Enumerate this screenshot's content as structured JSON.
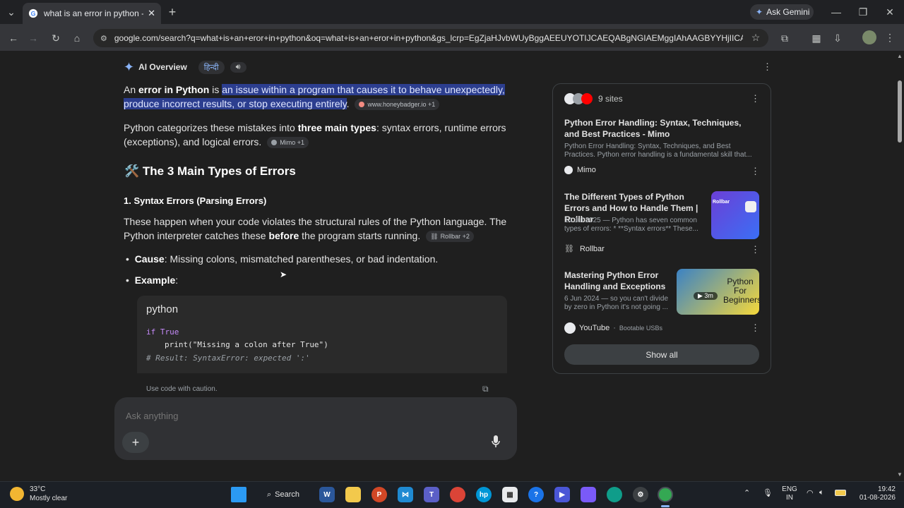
{
  "browser": {
    "tab_title": "what is an error in python - Goo",
    "url": "google.com/search?q=what+is+an+eror+in+python&oq=what+is+an+eror+in+python&gs_lcrp=EgZjaHJvbWUyBggAEEUYOTIJCAEQABgNGIAEMggIAhAAGBYYHjIICAMQ...",
    "ask_gemini": "Ask Gemini"
  },
  "overview": {
    "label": "AI Overview",
    "hindi": "हिन्दी",
    "p1_pre": "An ",
    "p1_bold": "error in Python",
    "p1_mid": " is ",
    "p1_hl1": "an issue within a program that causes it to behave unexpectedly,",
    "p1_hl2": "produce incorrect results, or stop executing entirely",
    "p1_end": ".",
    "p1_chip": "www.honeybadger.io +1",
    "p2_pre": "Python categorizes these mistakes into ",
    "p2_bold": "three main types",
    "p2_end1": ": syntax errors, runtime errors",
    "p2_end2": "(exceptions), and logical errors.",
    "p2_chip": "Mimo +1",
    "h2": "🛠️ The 3 Main Types of Errors",
    "h3": "1. Syntax Errors (Parsing Errors)",
    "p3_line1": "These happen when your code violates the structural rules of the Python language. The",
    "p3_pre": "Python interpreter catches these ",
    "p3_bold": "before",
    "p3_end": " the program starts running.",
    "p3_chip": "Rollbar +2",
    "b1_bold": "Cause",
    "b1_text": ": Missing colons, mismatched parentheses, or bad indentation.",
    "b2_bold": "Example",
    "b2_text": ":",
    "code_lang": "python",
    "code_l1_kw": "if",
    "code_l1_rest": " True",
    "code_l2_fn": "print(",
    "code_l2_str": "\"Missing a colon after True\"",
    "code_l2_end": ")",
    "code_l3": "# Result: SyntaxError: expected ':'",
    "caution": "Use code with caution."
  },
  "sources": {
    "count": "9 sites",
    "items": [
      {
        "title": "Python Error Handling: Syntax, Techniques, and Best Practices - Mimo",
        "snippet": "Python Error Handling: Syntax, Techniques, and Best Practices. Python error handling is a fundamental skill that...",
        "source": "Mimo"
      },
      {
        "title": "The Different Types of Python Errors and How to Handle Them | Rollbar",
        "snippet": "14 Jul 2025 — Python has seven common types of errors: * **Syntax errors** These...",
        "source": "Rollbar",
        "thumb_text": "Rollbar"
      },
      {
        "title": "Mastering Python Error Handling and Exceptions",
        "snippet": "6 Jun 2024 — so you can't divide by zero in Python it's not going ...",
        "source": "YouTube",
        "source_extra": "Bootable USBs",
        "thumb_text": "Python For Beginners",
        "duration": "3m"
      }
    ],
    "show_all": "Show all"
  },
  "ask": {
    "placeholder": "Ask anything"
  },
  "taskbar": {
    "temp": "33°C",
    "weather": "Mostly clear",
    "search": "Search",
    "lang1": "ENG",
    "lang2": "IN",
    "time": "19:42",
    "date": "01-08-2026"
  }
}
